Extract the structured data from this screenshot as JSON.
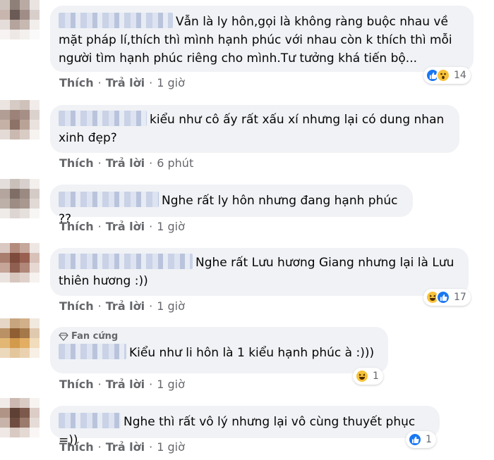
{
  "colors": {
    "bubble": "#f0f2f5",
    "meta": "#65676b",
    "like": "#1877f2",
    "emoji": "#f7c33a"
  },
  "actions": {
    "like": "Thích",
    "reply": "Trả lời"
  },
  "comments": [
    {
      "text": "Vẫn là ly hôn,gọi là không ràng buộc nhau về mặt pháp lí,thích thì mình hạnh phúc với nhau còn k thích thì mỗi người tìm hạnh phúc riêng cho mình.Tư tưởng khá tiến bộ...",
      "time": "1 giờ",
      "reactions": {
        "icons": [
          "like-icon",
          "wow-icon"
        ],
        "count": "14"
      }
    },
    {
      "text": "kiểu như cô ấy rất xấu xí nhưng lại có dung nhan xinh đẹp?",
      "time": "6 phút"
    },
    {
      "text": "Nghe rất ly hôn nhưng đang hạnh phúc ??",
      "time": "1 giờ"
    },
    {
      "text": "Nghe rất Lưu hương Giang nhưng lại là Lưu thiên hương :))",
      "time": "1 giờ",
      "reactions": {
        "icons": [
          "haha-icon",
          "like-icon"
        ],
        "count": "17"
      }
    },
    {
      "badge": "Fan cứng",
      "text": "Kiểu như li hôn là 1 kiểu hạnh phúc à :)))",
      "time": "1 giờ",
      "reactions": {
        "icons": [
          "haha-icon"
        ],
        "count": "1"
      }
    },
    {
      "text": "Nghe thì rất vô lý nhưng lại vô cùng thuyết phục =))",
      "time": "1 giờ",
      "reactions": {
        "icons": [
          "like-icon"
        ],
        "count": "1"
      }
    }
  ]
}
